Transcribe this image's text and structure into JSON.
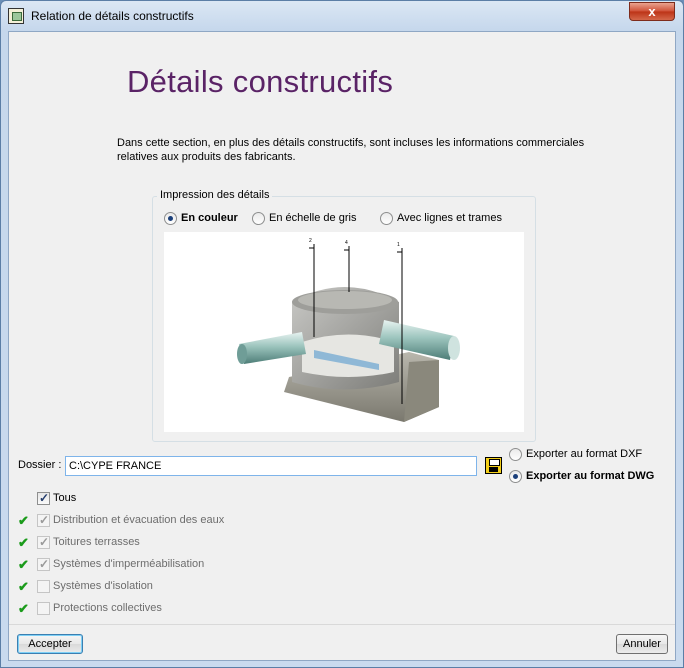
{
  "window": {
    "title": "Relation de détails constructifs",
    "close_label": "x"
  },
  "heading": "Détails constructifs",
  "intro": "Dans cette section, en plus des détails constructifs, sont incluses les informations commerciales relatives aux produits des fabricants.",
  "print": {
    "legend": "Impression des détails",
    "options": [
      {
        "label": "En couleur",
        "selected": true
      },
      {
        "label": "En échelle de gris",
        "selected": false
      },
      {
        "label": "Avec lignes et trames",
        "selected": false
      }
    ]
  },
  "preview": {
    "callouts": [
      "2",
      "4",
      "1"
    ]
  },
  "folder": {
    "label": "Dossier :",
    "value": "C:\\CYPE FRANCE"
  },
  "export": {
    "options": [
      {
        "label": "Exporter au format DXF",
        "selected": false
      },
      {
        "label": "Exporter au format DWG",
        "selected": true
      }
    ]
  },
  "categories": {
    "all_label": "Tous",
    "items": [
      {
        "label": "Distribution et évacuation des eaux",
        "checked": true
      },
      {
        "label": "Toitures terrasses",
        "checked": true
      },
      {
        "label": "Systèmes d'imperméabilisation",
        "checked": true
      },
      {
        "label": "Systèmes d'isolation",
        "checked": false
      },
      {
        "label": "Protections collectives",
        "checked": false
      }
    ]
  },
  "buttons": {
    "accept": "Accepter",
    "cancel": "Annuler"
  },
  "colors": {
    "heading": "#5a2366",
    "tick": "#1b9b1b"
  }
}
